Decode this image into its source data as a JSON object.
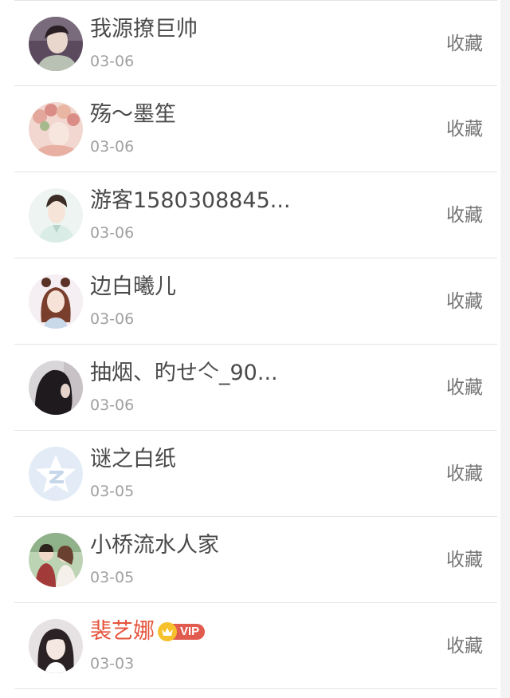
{
  "users": [
    {
      "name": "我源撩巨帅",
      "date": "03-06",
      "action": "收藏",
      "avatar": "woman-portrait-avatar"
    },
    {
      "name": "殇～墨笙",
      "date": "03-06",
      "action": "收藏",
      "avatar": "flower-crown-avatar"
    },
    {
      "name": "游客1580308845...",
      "date": "03-06",
      "action": "收藏",
      "avatar": "anime-man-avatar"
    },
    {
      "name": "边白曦儿",
      "date": "03-06",
      "action": "收藏",
      "avatar": "anime-girl-avatar"
    },
    {
      "name": "抽烟、旳せ亽_90...",
      "date": "03-06",
      "action": "收藏",
      "avatar": "dark-hair-avatar"
    },
    {
      "name": "谜之白纸",
      "date": "03-05",
      "action": "收藏",
      "avatar": "qzone-star-avatar"
    },
    {
      "name": "小桥流水人家",
      "date": "03-05",
      "action": "收藏",
      "avatar": "couple-avatar"
    },
    {
      "name": "裴艺娜",
      "date": "03-03",
      "action": "收藏",
      "avatar": "girl-photo-avatar",
      "vip": "VIP"
    }
  ],
  "colors": {
    "name": "#4a4a4a",
    "vip_name": "#e5533a",
    "date": "#a0a0a0",
    "action": "#757575",
    "divider": "#e4e4e4",
    "vip_badge": "#e25b4f",
    "crown": "#f6c12c"
  }
}
